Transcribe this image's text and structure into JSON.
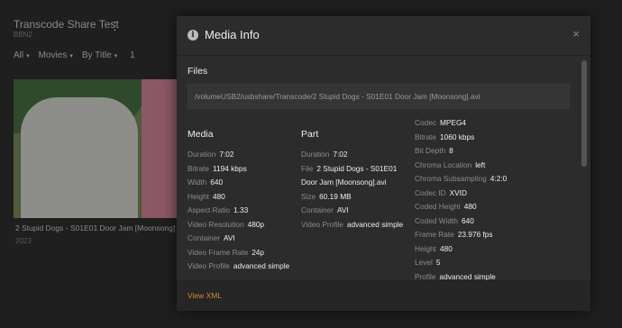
{
  "library": {
    "title": "Transcode Share Test",
    "server": "BBN2",
    "filters": [
      {
        "label": "All",
        "caret": "▾"
      },
      {
        "label": "Movies",
        "caret": "▾"
      },
      {
        "label": "By Title",
        "caret": "▾"
      }
    ],
    "count": "1",
    "menu_glyph": "⋮",
    "card": {
      "title": "2 Stupid Dogs - S01E01 Door Jam [Moonsong]",
      "year": "2023"
    }
  },
  "modal": {
    "title": "Media Info",
    "info_glyph": "i",
    "close_glyph": "×",
    "files_heading": "Files",
    "file_path": "/volumeUSB2/usbshare/Transcode/2 Stupid Dogs - S01E01 Door Jam [Moonsong].avi",
    "media": {
      "heading": "Media",
      "rows": [
        {
          "k": "Duration",
          "v": "7:02"
        },
        {
          "k": "Bitrate",
          "v": "1194 kbps"
        },
        {
          "k": "Width",
          "v": "640"
        },
        {
          "k": "Height",
          "v": "480"
        },
        {
          "k": "Aspect Ratio",
          "v": "1.33"
        },
        {
          "k": "Video Resolution",
          "v": "480p"
        },
        {
          "k": "Container",
          "v": "AVI"
        },
        {
          "k": "Video Frame Rate",
          "v": "24p"
        },
        {
          "k": "Video Profile",
          "v": "advanced simple"
        }
      ]
    },
    "part": {
      "heading": "Part",
      "rows": [
        {
          "k": "Duration",
          "v": "7:02"
        },
        {
          "k": "File",
          "v": "2 Stupid Dogs - S01E01 Door Jam [Moonsong].avi"
        },
        {
          "k": "Size",
          "v": "60.19 MB"
        },
        {
          "k": "Container",
          "v": "AVI"
        },
        {
          "k": "Video Profile",
          "v": "advanced simple"
        }
      ]
    },
    "codec": {
      "rows": [
        {
          "k": "Codec",
          "v": "MPEG4"
        },
        {
          "k": "Bitrate",
          "v": "1060 kbps"
        },
        {
          "k": "Bit Depth",
          "v": "8"
        },
        {
          "k": "Chroma Location",
          "v": "left"
        },
        {
          "k": "Chroma Subsampling",
          "v": "4:2:0"
        },
        {
          "k": "Codec ID",
          "v": "XVID"
        },
        {
          "k": "Coded Height",
          "v": "480"
        },
        {
          "k": "Coded Width",
          "v": "640"
        },
        {
          "k": "Frame Rate",
          "v": "23.976 fps"
        },
        {
          "k": "Height",
          "v": "480"
        },
        {
          "k": "Level",
          "v": "5"
        },
        {
          "k": "Profile",
          "v": "advanced simple"
        }
      ]
    },
    "footer_link": "View XML",
    "colors": {
      "accent": "#cc8a2e",
      "modal_bg": "#2c2c2c",
      "page_bg": "#1f1f1f"
    }
  }
}
